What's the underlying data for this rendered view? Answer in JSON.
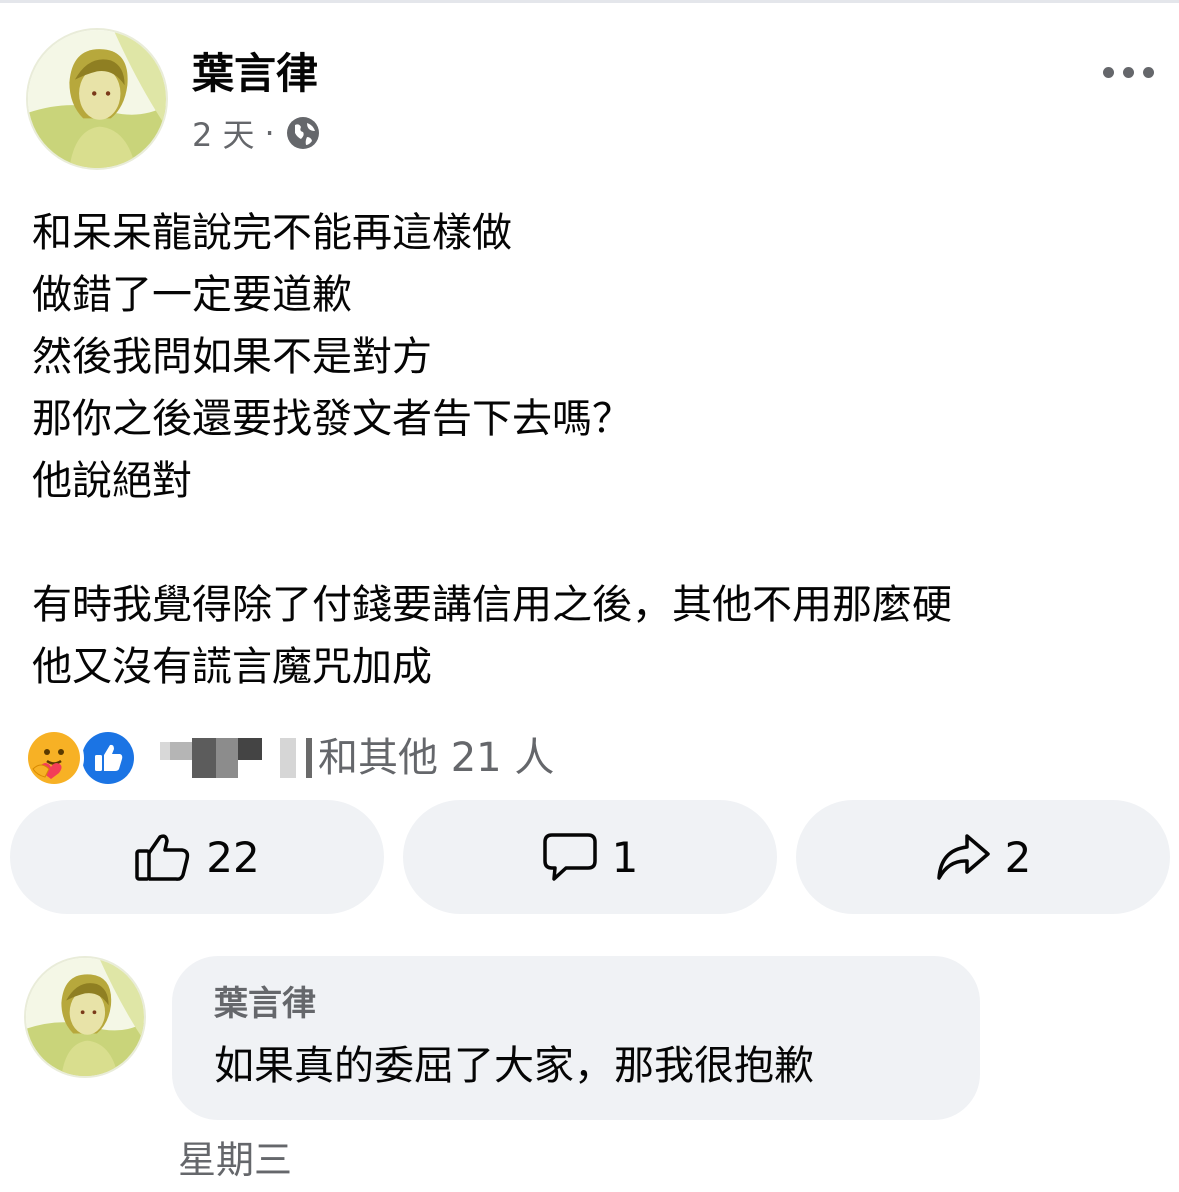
{
  "post": {
    "author": "葉言律",
    "time": "2 天",
    "separator": "·",
    "privacy_icon": "globe-icon",
    "more_icon": "more-options-icon",
    "body_lines": [
      "和呆呆龍說完不能再這樣做",
      "做錯了一定要道歉",
      "然後我問如果不是對方",
      "那你之後還要找發文者告下去嗎？",
      "他說絕對",
      "",
      "有時我覺得除了付錢要講信用之後，其他不用那麼硬",
      "他又沒有謊言魔咒加成"
    ]
  },
  "reactions": {
    "icons": [
      "care-reaction-icon",
      "like-reaction-icon"
    ],
    "summary": "和其他 21 人"
  },
  "actions": {
    "like_count": "22",
    "comment_count": "1",
    "share_count": "2"
  },
  "comment": {
    "author": "葉言律",
    "text": "如果真的委屈了大家，那我很抱歉",
    "time": "星期三"
  },
  "colors": {
    "text": "#050505",
    "secondary_text": "#65676b",
    "button_bg": "#f0f2f5",
    "like_blue": "#1b74e4",
    "care_orange": "#f7b125"
  }
}
